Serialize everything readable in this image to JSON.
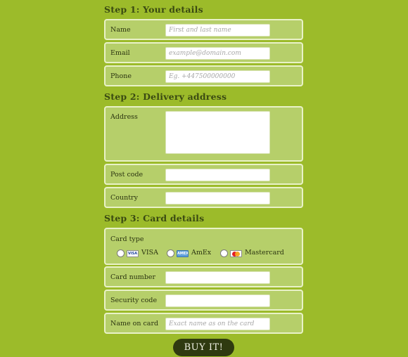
{
  "steps": {
    "step1": "Step 1: Your details",
    "step2": "Step 2: Delivery address",
    "step3": "Step 3: Card details"
  },
  "fields": {
    "name": {
      "label": "Name",
      "placeholder": "First and last name"
    },
    "email": {
      "label": "Email",
      "placeholder": "example@domain.com"
    },
    "phone": {
      "label": "Phone",
      "placeholder": "Eg. +447500000000"
    },
    "address": {
      "label": "Address",
      "placeholder": ""
    },
    "postcode": {
      "label": "Post code",
      "placeholder": ""
    },
    "country": {
      "label": "Country",
      "placeholder": ""
    },
    "card_type": {
      "label": "Card type"
    },
    "card_number": {
      "label": "Card number",
      "placeholder": ""
    },
    "security_code": {
      "label": "Security code",
      "placeholder": ""
    },
    "name_on_card": {
      "label": "Name on card",
      "placeholder": "Exact name as on the card"
    }
  },
  "card_options": [
    {
      "label": "VISA",
      "icon": "visa-card-icon",
      "icon_text": "VISA"
    },
    {
      "label": "AmEx",
      "icon": "amex-card-icon",
      "icon_text": "AMEX"
    },
    {
      "label": "Mastercard",
      "icon": "mastercard-icon",
      "icon_text": ""
    }
  ],
  "submit_label": "BUY IT!",
  "colors": {
    "background": "#9cbb2a",
    "row_background": "#b6cf6a",
    "row_border": "#e9f2c8",
    "button": "#2f3a10"
  }
}
